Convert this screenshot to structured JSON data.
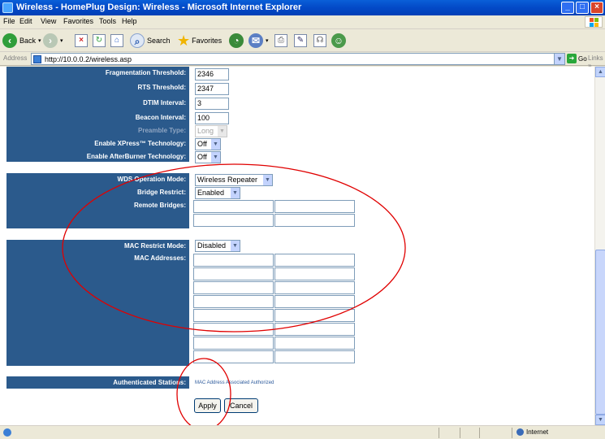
{
  "window": {
    "title": "Wireless - HomePlug Design: Wireless - Microsoft Internet Explorer",
    "min_glyph": "_",
    "max_glyph": "□",
    "close_glyph": "×"
  },
  "menu": [
    "File",
    "Edit",
    "View",
    "Favorites",
    "Tools",
    "Help"
  ],
  "toolbar": {
    "back": "Back",
    "search": "Search",
    "favorites": "Favorites"
  },
  "address": {
    "label": "Address",
    "url": "http://10.0.0.2/wireless.asp",
    "go": "Go",
    "links": "Links »"
  },
  "wireless": {
    "frag_label": "Fragmentation Threshold:",
    "frag_value": "2346",
    "rts_label": "RTS Threshold:",
    "rts_value": "2347",
    "dtim_label": "DTIM Interval:",
    "dtim_value": "3",
    "beacon_label": "Beacon Interval:",
    "beacon_value": "100",
    "preamble_label": "Preamble Type:",
    "preamble_value": "Long",
    "xpress_label": "Enable XPress™ Technology:",
    "xpress_value": "Off",
    "afterburner_label": "Enable AfterBurner Technology:",
    "afterburner_value": "Off"
  },
  "wds": {
    "mode_label": "WDS Operation Mode:",
    "mode_value": "Wireless Repeater",
    "restrict_label": "Bridge Restrict:",
    "restrict_value": "Enabled",
    "remote_label": "Remote Bridges:"
  },
  "mac": {
    "mode_label": "MAC Restrict Mode:",
    "mode_value": "Disabled",
    "addresses_label": "MAC Addresses:"
  },
  "stations": {
    "label": "Authenticated Stations:",
    "columns": "MAC Address  Associated  Authorized"
  },
  "buttons": {
    "apply": "Apply",
    "cancel": "Cancel"
  },
  "status": {
    "zone": "Internet"
  },
  "colors": {
    "panel": "#2b5a8c",
    "annotation": "#e00000"
  }
}
